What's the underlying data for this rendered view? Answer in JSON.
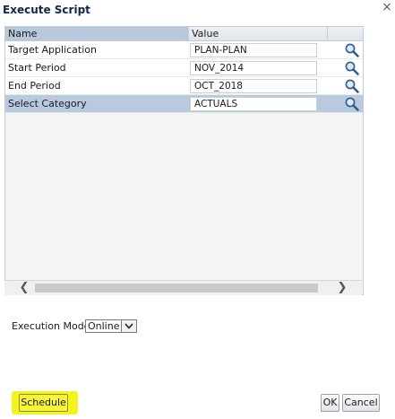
{
  "dialog": {
    "title": "Execute Script",
    "close_glyph": "×"
  },
  "grid": {
    "columns": {
      "name": "Name",
      "value": "Value"
    },
    "rows": [
      {
        "name": "Target Application",
        "value": "PLAN-PLAN",
        "selected": false
      },
      {
        "name": "Start Period",
        "value": "NOV_2014",
        "selected": false
      },
      {
        "name": "End Period",
        "value": "OCT_2018",
        "selected": false
      },
      {
        "name": "Select Category",
        "value": "ACTUALS",
        "selected": true
      }
    ],
    "search_icon": "magnifier-icon"
  },
  "scrollbar": {
    "left_arrow": "❮",
    "right_arrow": "❯"
  },
  "execution_mode": {
    "label": "Execution Mode",
    "selected": "Online"
  },
  "buttons": {
    "schedule": "Schedule",
    "ok": "OK",
    "cancel": "Cancel"
  },
  "colors": {
    "selected_row": "#b9c9de",
    "highlight": "#f4f31d",
    "title": "#12254a"
  }
}
